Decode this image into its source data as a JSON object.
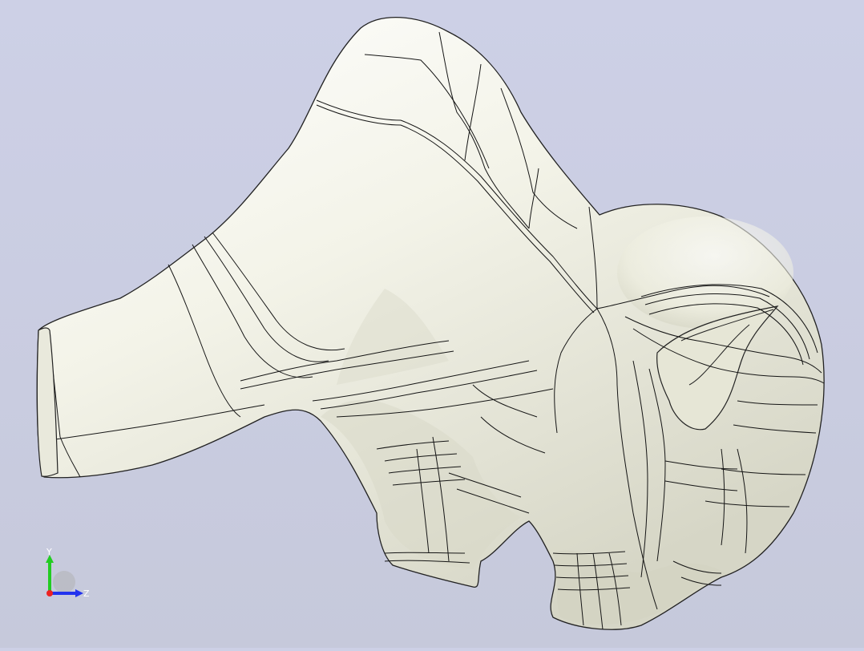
{
  "viewer": {
    "background_color": "#cbcee3",
    "model_color": "#f2f2e6",
    "edge_color": "#111111"
  },
  "triad": {
    "y_label": "Y",
    "z_label": "Z",
    "y_color": "#22cc22",
    "z_color": "#2233ee",
    "x_color": "#ee2222"
  }
}
